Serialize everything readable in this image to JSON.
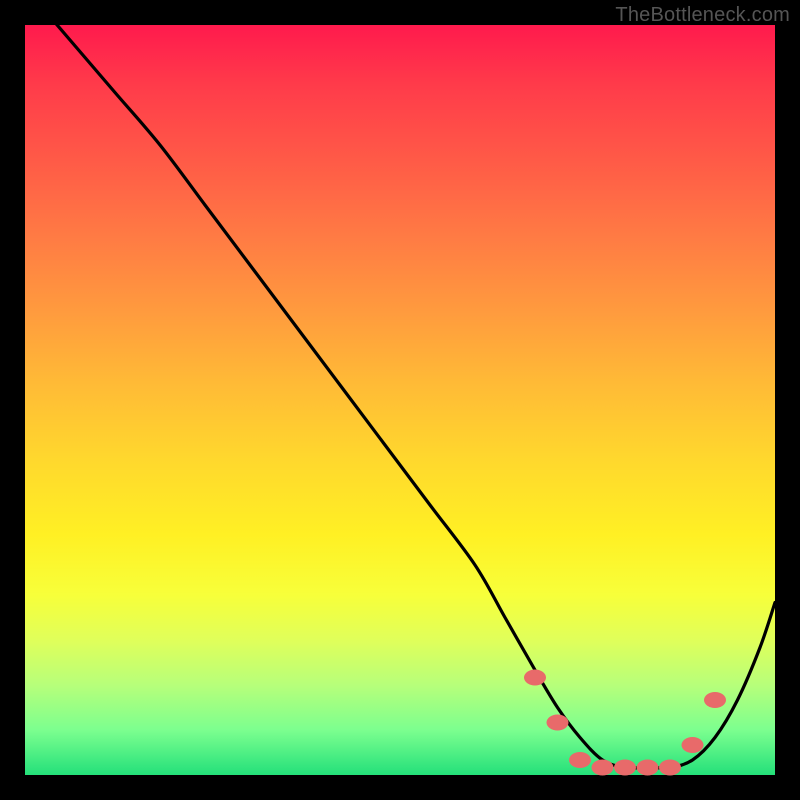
{
  "watermark": "TheBottleneck.com",
  "colors": {
    "frame": "#000000",
    "gradient_top": "#ff1a4d",
    "gradient_bottom": "#24e07a",
    "curve": "#000000",
    "marker": "#e86a6a"
  },
  "chart_data": {
    "type": "line",
    "title": "",
    "xlabel": "",
    "ylabel": "",
    "xlim": [
      0,
      100
    ],
    "ylim": [
      0,
      100
    ],
    "grid": false,
    "legend": false,
    "series": [
      {
        "name": "bottleneck-curve",
        "x": [
          0,
          6,
          12,
          18,
          24,
          30,
          36,
          42,
          48,
          54,
          60,
          64,
          68,
          71,
          74,
          77,
          80,
          83,
          86,
          89,
          92,
          95,
          98,
          100
        ],
        "y": [
          105,
          98,
          91,
          84,
          76,
          68,
          60,
          52,
          44,
          36,
          28,
          21,
          14,
          9,
          5,
          2,
          1,
          1,
          1,
          2,
          5,
          10,
          17,
          23
        ]
      }
    ],
    "markers": {
      "name": "bottleneck-markers",
      "x": [
        68,
        71,
        74,
        77,
        80,
        83,
        86,
        89,
        92
      ],
      "y": [
        13,
        7,
        2,
        1,
        1,
        1,
        1,
        4,
        10
      ]
    },
    "annotations": []
  }
}
